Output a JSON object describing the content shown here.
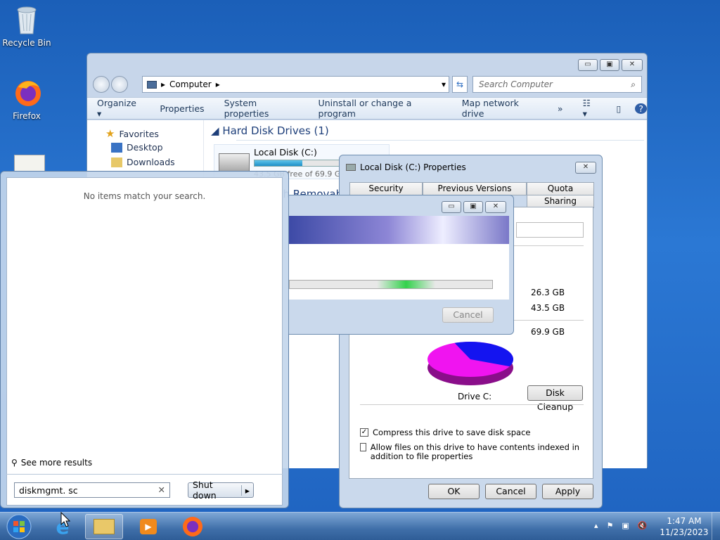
{
  "desktop": {
    "icons": [
      {
        "label": "Recycle Bin",
        "name": "recycle-bin-icon"
      },
      {
        "label": "Firefox",
        "name": "firefox-icon"
      }
    ]
  },
  "explorer": {
    "address": "Computer",
    "search_placeholder": "Search Computer",
    "toolbar": [
      "Organize",
      "Properties",
      "System properties",
      "Uninstall or change a program",
      "Map network drive",
      "»"
    ],
    "nav": {
      "favorites": "Favorites",
      "desktop": "Desktop",
      "downloads": "Downloads"
    },
    "section_hdd": "Hard Disk Drives (1)",
    "section_removable": "Devices with Removable Storage",
    "drive_name": "Local Disk (C:)",
    "drive_free": "43.5 GB free of 69.9 GB",
    "drive_fill": 0.38
  },
  "startmenu": {
    "no_results": "No items match your search.",
    "see_more": "See more results",
    "search_value": "diskmgmt. sc",
    "shutdown": "Shut down"
  },
  "props": {
    "title": "Local Disk (C:) Properties",
    "tabs_top": [
      "Security",
      "Previous Versions",
      "Quota"
    ],
    "tabs_bottom": [
      "Sharing"
    ],
    "used": "26.3 GB",
    "free": "43.5 GB",
    "capacity": "69.9 GB",
    "used_fraction": 0.376,
    "drive_label": "Drive C:",
    "disk_cleanup": "Disk Cleanup",
    "compress": "Compress this drive to save disk space",
    "compress_checked": true,
    "index": "Allow files on this drive to have contents indexed in addition to file properties",
    "index_checked": false,
    "ok": "OK",
    "cancel": "Cancel",
    "apply": "Apply",
    "used_color": "#1414f0",
    "free_color": "#f014f0"
  },
  "progress_dialog": {
    "cancel": "Cancel",
    "progress_fraction": 0.72
  },
  "taskbar": {
    "time": "1:47 AM",
    "date": "11/23/2023"
  }
}
